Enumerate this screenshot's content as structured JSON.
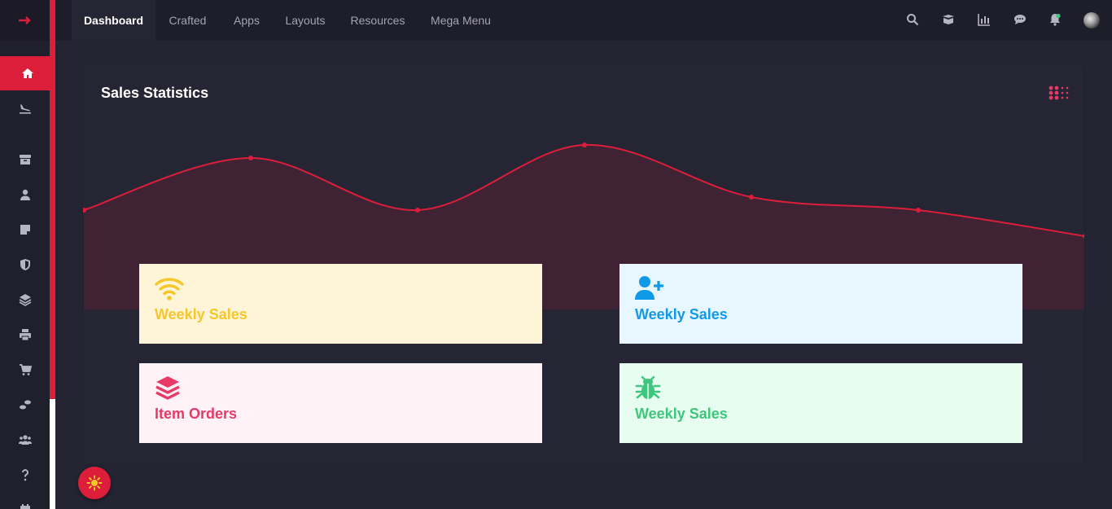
{
  "nav": {
    "tabs": [
      {
        "label": "Dashboard",
        "active": true
      },
      {
        "label": "Crafted"
      },
      {
        "label": "Apps"
      },
      {
        "label": "Layouts"
      },
      {
        "label": "Resources"
      },
      {
        "label": "Mega Menu"
      }
    ],
    "right_icons": [
      "search-icon",
      "box-icon",
      "chart-icon",
      "chat-icon",
      "bell-icon",
      "user-avatar"
    ]
  },
  "sidebar": {
    "items": [
      "home-icon",
      "plane-landing-icon",
      "archive-icon",
      "user-icon",
      "note-icon",
      "shield-icon",
      "layers-icon",
      "printer-icon",
      "cart-icon",
      "footprints-icon",
      "users-icon",
      "question-icon",
      "calendar-icon"
    ]
  },
  "card": {
    "title": "Sales Statistics"
  },
  "chart_data": {
    "type": "area",
    "x": [
      0,
      1,
      2,
      3,
      4,
      5,
      6
    ],
    "values": [
      30,
      40,
      30,
      42.5,
      32.5,
      30,
      25
    ],
    "ylim": [
      0,
      50
    ],
    "color": "#dc1e3a",
    "grid": false
  },
  "stats": [
    {
      "label": "Weekly Sales",
      "icon": "wifi-icon",
      "bg": "#fef5d8",
      "color": "#f6c62b"
    },
    {
      "label": "Weekly Sales",
      "icon": "user-plus-icon",
      "bg": "#e8f6ff",
      "color": "#0f9ae8"
    },
    {
      "label": "Item Orders",
      "icon": "layers-icon",
      "bg": "#fef2f6",
      "color": "#e73a66"
    },
    {
      "label": "Weekly Sales",
      "icon": "bug-icon",
      "bg": "#e6fdf0",
      "color": "#3ec67c"
    }
  ],
  "colors": {
    "accent": "#dc1e3a",
    "background": "#252433",
    "topbar": "#1e1d2a"
  }
}
